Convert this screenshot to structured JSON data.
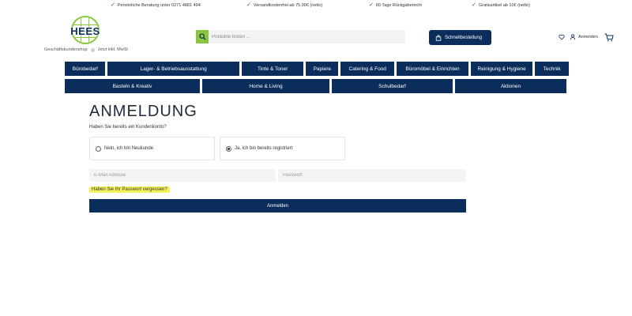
{
  "topbar": {
    "usps": [
      "Persönliche Beratung unter 0271 4881 494",
      "Versandkostenfrei ab 75,00€ (netto)",
      "60 Tage Rückgaberecht",
      "Gratisartikel ab 10€ (netto)"
    ]
  },
  "brand": {
    "name": "HEES",
    "sub_left": "Geschäftskundenshop",
    "sub_right": "Jetzt inkl. MwSt",
    "accent": "#8cc63f",
    "navy": "#0b2d5b"
  },
  "search": {
    "placeholder": "Produkte finden ..."
  },
  "header": {
    "quick_order": "Schnellbestellung",
    "login": "Anmelden"
  },
  "nav": {
    "row1": [
      "Bürobedarf",
      "Lager- & Betriebsausstattung",
      "Tinte & Toner",
      "Papiere",
      "Catering & Food",
      "Büromöbel & Einrichten",
      "Reinigung & Hygiene",
      "Technik"
    ],
    "row2": [
      "Basteln & Kreativ",
      "Home & Living",
      "Schulbedarf",
      "Aktionen"
    ]
  },
  "login": {
    "title": "ANMELDUNG",
    "question": "Haben Sie bereits ein Kundenkonto?",
    "option_no": "Nein, ich bin Neukunde",
    "option_yes": "Ja, ich bin bereits registriert",
    "email_placeholder": "E-Mail Adresse",
    "password_placeholder": "Passwort",
    "forgot": "Haben Sie Ihr Passwort vergessen?",
    "submit": "Anmelden"
  }
}
